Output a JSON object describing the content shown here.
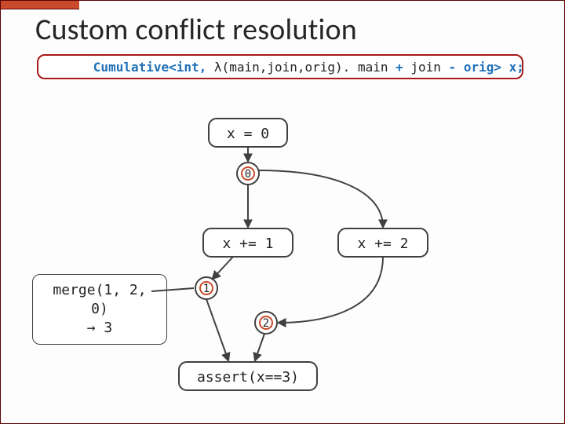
{
  "title": "Custom conflict resolution",
  "code": {
    "pre": "Cumulative<int, ",
    "lam": "λ(",
    "args": "main,join,orig). main ",
    "plus": "+",
    "mid": " join ",
    "minus": "-",
    "tail": " orig> x;"
  },
  "states": {
    "init": "x = 0",
    "left": "x += 1",
    "right": "x += 2",
    "assert": "assert(x==3)"
  },
  "values": {
    "v0": "0",
    "v1": "1",
    "v2": "2"
  },
  "merge": {
    "line1": "merge(1, 2, 0)",
    "line2": "→ 3"
  }
}
